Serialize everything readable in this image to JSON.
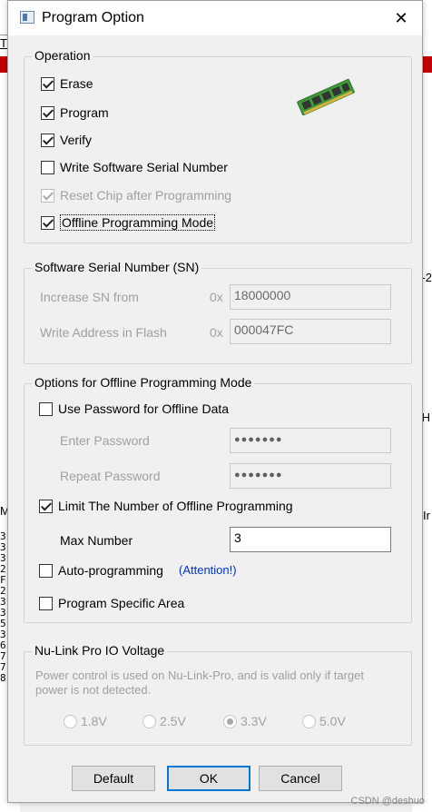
{
  "window": {
    "title": "Program Option",
    "close_glyph": "✕"
  },
  "operation": {
    "legend": "Operation",
    "items": [
      {
        "label": "Erase",
        "checked": true,
        "enabled": true
      },
      {
        "label": "Program",
        "checked": true,
        "enabled": true
      },
      {
        "label": "Verify",
        "checked": true,
        "enabled": true
      },
      {
        "label": "Write Software Serial Number",
        "checked": false,
        "enabled": true
      },
      {
        "label": "Reset Chip after Programming",
        "checked": true,
        "enabled": false
      },
      {
        "label": "Offline Programming Mode",
        "checked": true,
        "enabled": true
      }
    ],
    "icon": "memory-module-icon"
  },
  "serial": {
    "legend": "Software Serial Number (SN)",
    "increase_label": "Increase SN from",
    "increase_prefix": "0x",
    "increase_value": "18000000",
    "address_label": "Write Address in Flash",
    "address_prefix": "0x",
    "address_value": "000047FC"
  },
  "offline": {
    "legend": "Options for Offline Programming Mode",
    "use_password_label": "Use Password for Offline Data",
    "enter_password_label": "Enter Password",
    "enter_password_value": "●●●●●●●",
    "repeat_password_label": "Repeat Password",
    "repeat_password_value": "●●●●●●●",
    "limit_label": "Limit The Number of Offline Programming",
    "max_label": "Max Number",
    "max_value": "3",
    "auto_label": "Auto-programming",
    "attention_link": "(Attention!)",
    "specific_label": "Program Specific Area"
  },
  "voltage": {
    "legend": "Nu-Link Pro IO Voltage",
    "description": "Power control is used on Nu-Link-Pro, and is valid only if target power is not detected.",
    "options": [
      "1.8V",
      "2.5V",
      "3.3V",
      "5.0V"
    ],
    "selected": "3.3V"
  },
  "buttons": {
    "default": "Default",
    "ok": "OK",
    "cancel": "Cancel"
  },
  "watermark": "CSDN @deshuo",
  "background": {
    "left_t": "T",
    "left_m": "M",
    "right_t1": "-2",
    "right_t2": "H",
    "right_t3": "Ir",
    "left_nums": "3\n3\n3\n2\nF\n2\n3\n3\n5\n3\n6\n7\n7\n8"
  },
  "colors": {
    "accent": "#0078d7",
    "link": "#0033cc",
    "disabled": "#a0a0a0"
  }
}
